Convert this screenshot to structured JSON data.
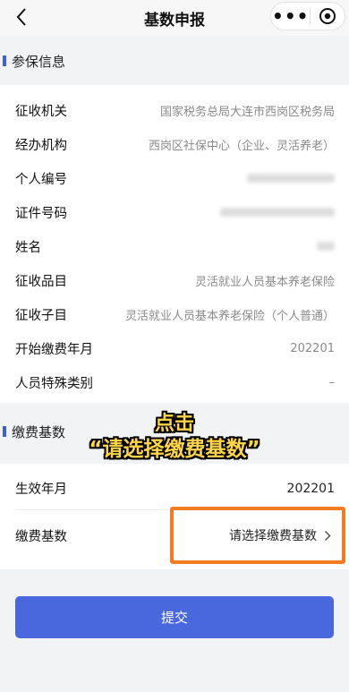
{
  "nav": {
    "title": "基数申报",
    "more_glyph": "•••"
  },
  "insured_section": {
    "title": "参保信息",
    "rows": [
      {
        "label": "征收机关",
        "value": "国家税务总局大连市西岗区税务局"
      },
      {
        "label": "经办机构",
        "value": "西岗区社保中心（企业、灵活养老）"
      },
      {
        "label": "个人编号",
        "value": ""
      },
      {
        "label": "证件号码",
        "value": ""
      },
      {
        "label": "姓名",
        "value": ""
      },
      {
        "label": "征收品目",
        "value": "灵活就业人员基本养老保险"
      },
      {
        "label": "征收子目",
        "value": "灵活就业人员基本养老保险（个人普通）"
      },
      {
        "label": "开始缴费年月",
        "value": "202201"
      },
      {
        "label": "人员特殊类别",
        "value": "–"
      }
    ]
  },
  "base_section": {
    "title": "缴费基数",
    "effective_label": "生效年月",
    "effective_value": "202201",
    "base_label": "缴费基数",
    "base_placeholder": "请选择缴费基数"
  },
  "submit_label": "提交",
  "overlay": {
    "line1": "点击",
    "line2": "“请选择缴费基数”"
  },
  "colors": {
    "accent": "#4a68de",
    "highlight_border": "#f07d22",
    "overlay_text": "#ffd54a"
  }
}
